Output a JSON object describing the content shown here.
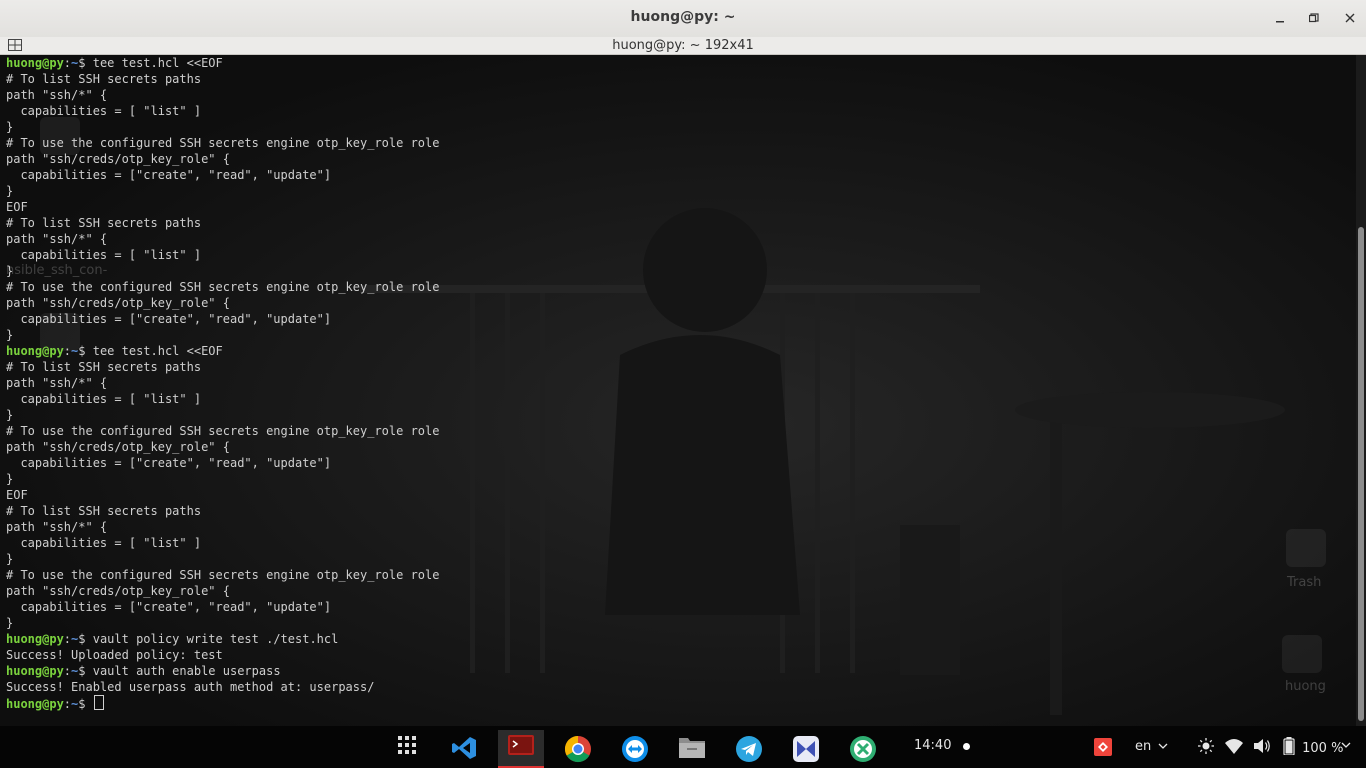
{
  "window": {
    "title": "huong@py: ~",
    "tab_title": "huong@py: ~ 192x41"
  },
  "terminal": {
    "prompt_user": "huong@py",
    "prompt_path": "~",
    "lines": [
      {
        "p": true,
        "t": "$ tee test.hcl <<EOF"
      },
      {
        "t": "# To list SSH secrets paths"
      },
      {
        "t": "path \"ssh/*\" {"
      },
      {
        "t": "  capabilities = [ \"list\" ]"
      },
      {
        "t": "}"
      },
      {
        "t": "# To use the configured SSH secrets engine otp_key_role role"
      },
      {
        "t": "path \"ssh/creds/otp_key_role\" {"
      },
      {
        "t": "  capabilities = [\"create\", \"read\", \"update\"]"
      },
      {
        "t": "}"
      },
      {
        "t": "EOF"
      },
      {
        "t": "# To list SSH secrets paths"
      },
      {
        "t": "path \"ssh/*\" {"
      },
      {
        "t": "  capabilities = [ \"list\" ]"
      },
      {
        "t": "}"
      },
      {
        "t": "# To use the configured SSH secrets engine otp_key_role role"
      },
      {
        "t": "path \"ssh/creds/otp_key_role\" {"
      },
      {
        "t": "  capabilities = [\"create\", \"read\", \"update\"]"
      },
      {
        "t": "}"
      },
      {
        "p": true,
        "t": "$ tee test.hcl <<EOF"
      },
      {
        "t": "# To list SSH secrets paths"
      },
      {
        "t": "path \"ssh/*\" {"
      },
      {
        "t": "  capabilities = [ \"list\" ]"
      },
      {
        "t": "}"
      },
      {
        "t": "# To use the configured SSH secrets engine otp_key_role role"
      },
      {
        "t": "path \"ssh/creds/otp_key_role\" {"
      },
      {
        "t": "  capabilities = [\"create\", \"read\", \"update\"]"
      },
      {
        "t": "}"
      },
      {
        "t": "EOF"
      },
      {
        "t": "# To list SSH secrets paths"
      },
      {
        "t": "path \"ssh/*\" {"
      },
      {
        "t": "  capabilities = [ \"list\" ]"
      },
      {
        "t": "}"
      },
      {
        "t": "# To use the configured SSH secrets engine otp_key_role role"
      },
      {
        "t": "path \"ssh/creds/otp_key_role\" {"
      },
      {
        "t": "  capabilities = [\"create\", \"read\", \"update\"]"
      },
      {
        "t": "}"
      },
      {
        "p": true,
        "t": "$ vault policy write test ./test.hcl"
      },
      {
        "t": "Success! Uploaded policy: test"
      },
      {
        "p": true,
        "t": "$ vault auth enable userpass"
      },
      {
        "t": "Success! Enabled userpass auth method at: userpass/"
      },
      {
        "p": true,
        "t": "$ ",
        "cursor": true
      }
    ]
  },
  "desktop": {
    "ghost_label": "nsible_ssh_con-",
    "trash_label": "Trash",
    "home_label": "huong"
  },
  "dock": {
    "apps": [
      {
        "name": "app-grid-icon"
      },
      {
        "name": "vscode-icon"
      },
      {
        "name": "terminal-icon",
        "active": true
      },
      {
        "name": "chrome-icon"
      },
      {
        "name": "teamviewer-icon"
      },
      {
        "name": "files-icon"
      },
      {
        "name": "telegram-icon"
      },
      {
        "name": "kdenlive-icon"
      },
      {
        "name": "crossover-icon"
      }
    ],
    "clock": "14:40",
    "language": "en",
    "battery": "100 %"
  },
  "colors": {
    "prompt_user": "#7bd33e",
    "prompt_path": "#5c8fd6",
    "terminal_text": "#cfcfcf",
    "titlebar": "#e4e3e0"
  }
}
